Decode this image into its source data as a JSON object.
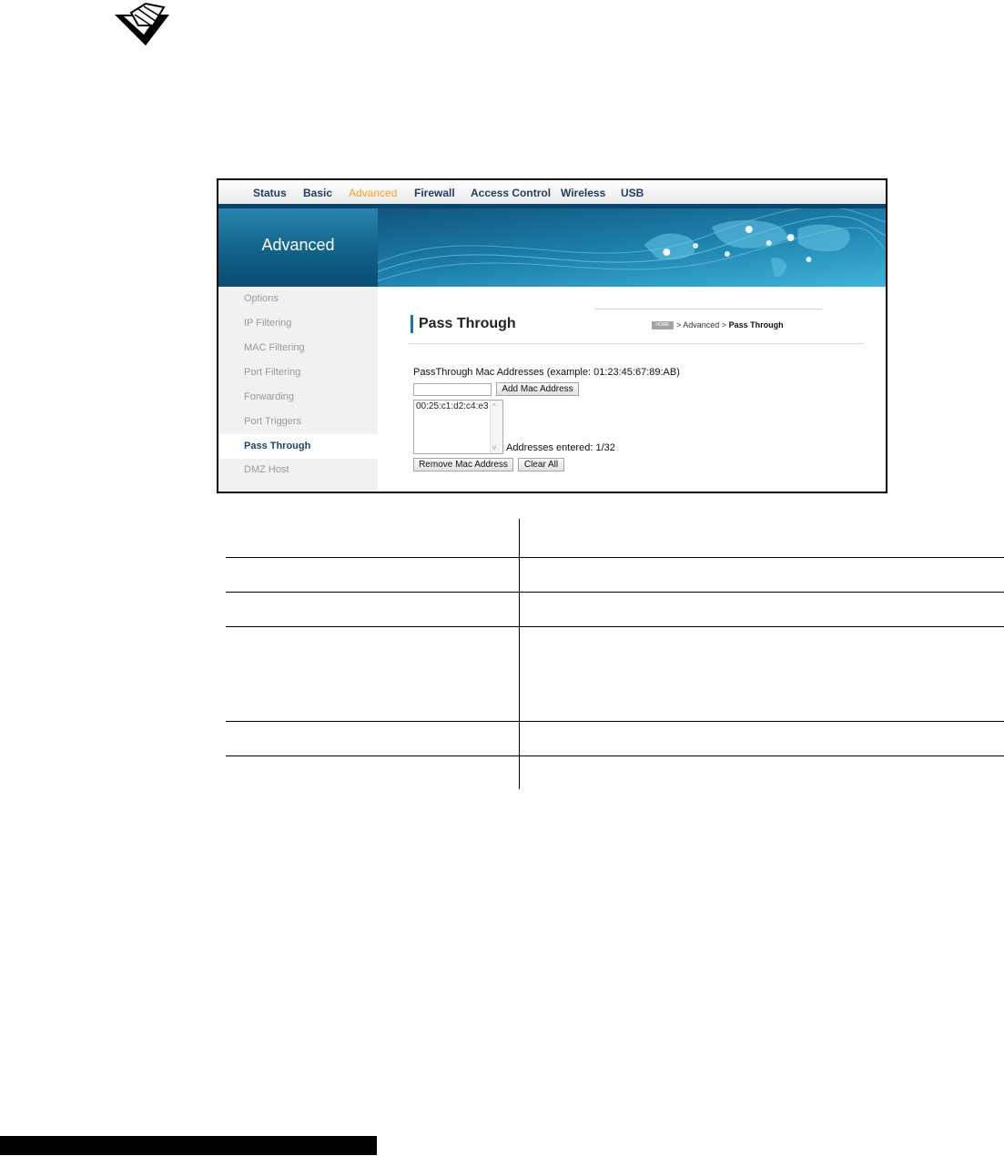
{
  "nav": {
    "items": [
      "Status",
      "Basic",
      "Advanced",
      "Firewall",
      "Access Control",
      "Wireless",
      "USB"
    ],
    "active": "Advanced"
  },
  "banner": {
    "title": "Advanced"
  },
  "sidebar": {
    "items": [
      "Options",
      "IP Filtering",
      "MAC Filtering",
      "Port Filtering",
      "Forwarding",
      "Port Triggers",
      "Pass Through",
      "DMZ Host"
    ],
    "active": "Pass Through"
  },
  "page": {
    "title": "Pass Through",
    "breadcrumb": {
      "home": "HOME",
      "path": "> Advanced >",
      "current": "Pass Through"
    }
  },
  "form": {
    "label": "PassThrough Mac Addresses (example: 01:23:45:67:89:AB)",
    "mac_input_value": "",
    "add_button": "Add Mac Address",
    "addresses": [
      "00:25:c1:d2:c4:e3"
    ],
    "entered_text": "Addresses entered: 1/32",
    "remove_button": "Remove Mac Address",
    "clear_button": "Clear All"
  },
  "colors": {
    "nav_text": "#1f3f66",
    "nav_active": "#f5a11b",
    "banner_dark": "#0b4d70",
    "sidebar_active": "#1b466b"
  }
}
